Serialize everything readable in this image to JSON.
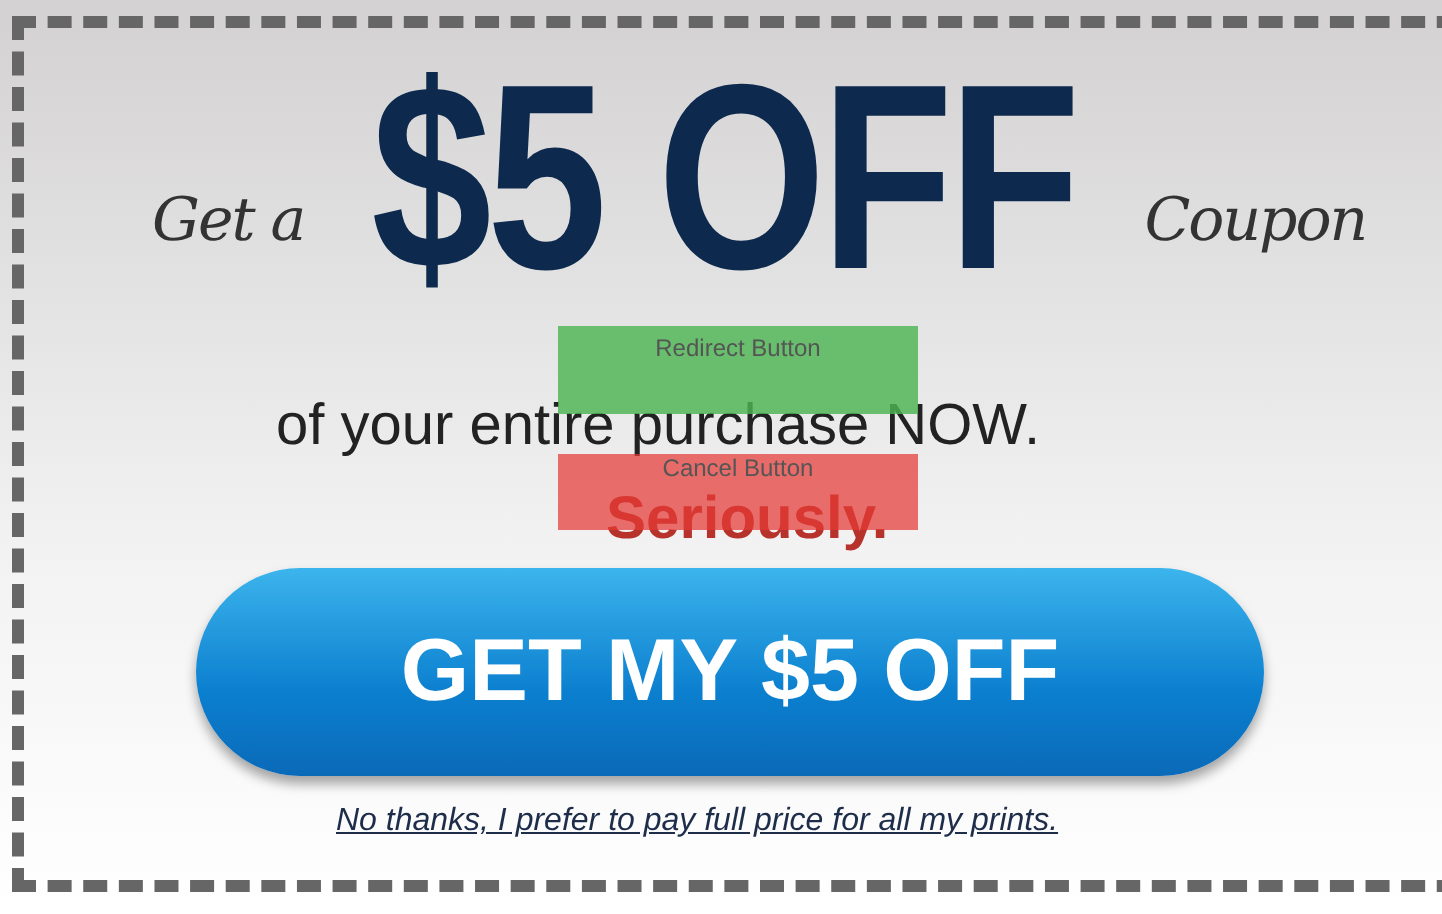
{
  "coupon": {
    "prefix": "Get a",
    "amount": "$5 OFF",
    "suffix": "Coupon",
    "subline": "of your entire purchase NOW.",
    "emphasis": "Seriously.",
    "cta": "GET MY $5 OFF",
    "decline_link": "No thanks, I prefer to pay full price for all my prints."
  },
  "overlays": [
    {
      "label": "Redirect Button",
      "kind": "redirect"
    },
    {
      "label": "Cancel Button",
      "kind": "cancel"
    }
  ]
}
